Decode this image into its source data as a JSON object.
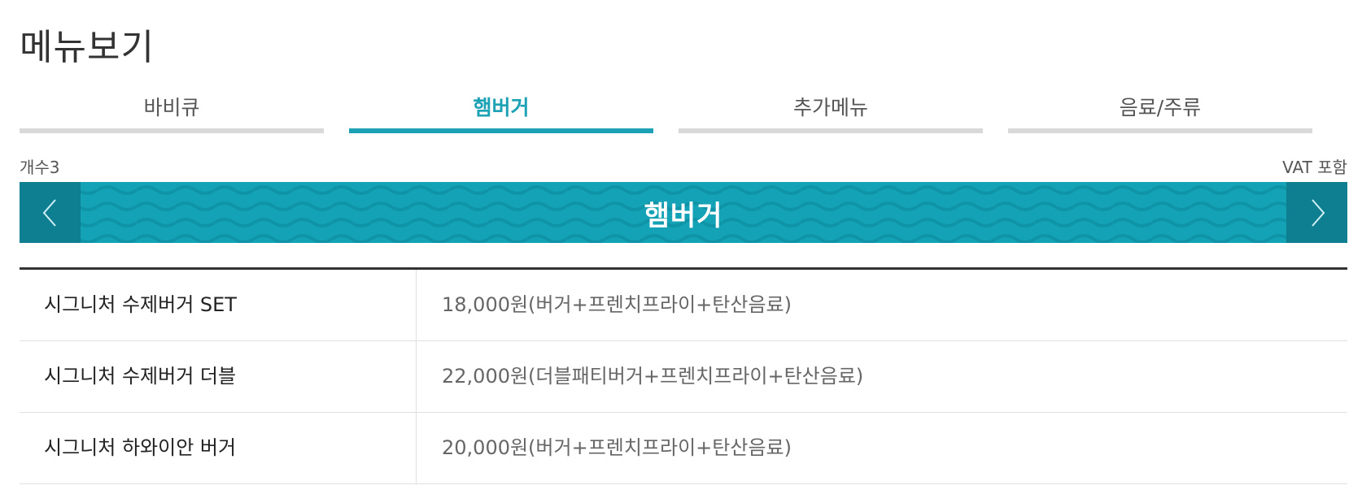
{
  "page": {
    "title": "메뉴보기"
  },
  "tabs": [
    {
      "label": "바비큐",
      "active": false
    },
    {
      "label": "햄버거",
      "active": true
    },
    {
      "label": "추가메뉴",
      "active": false
    },
    {
      "label": "음료/주류",
      "active": false
    }
  ],
  "meta": {
    "count": "개수3",
    "vat": "VAT 포함"
  },
  "banner": {
    "title": "햄버거",
    "prev_icon": "chevron-left-icon",
    "next_icon": "chevron-right-icon"
  },
  "menu": [
    {
      "name": "시그니처 수제버거 SET",
      "price": "18,000원(버거+프렌치프라이+탄산음료)"
    },
    {
      "name": "시그니처 수제버거 더블",
      "price": "22,000원(더블패티버거+프렌치프라이+탄산음료)"
    },
    {
      "name": "시그니처 하와이안 버거",
      "price": "20,000원(버거+프렌치프라이+탄산음료)"
    }
  ],
  "colors": {
    "accent": "#1da2b5",
    "banner": "#14a2b6",
    "nav": "#0e7f91",
    "inactive_tab_bar": "#d9d9d9"
  }
}
